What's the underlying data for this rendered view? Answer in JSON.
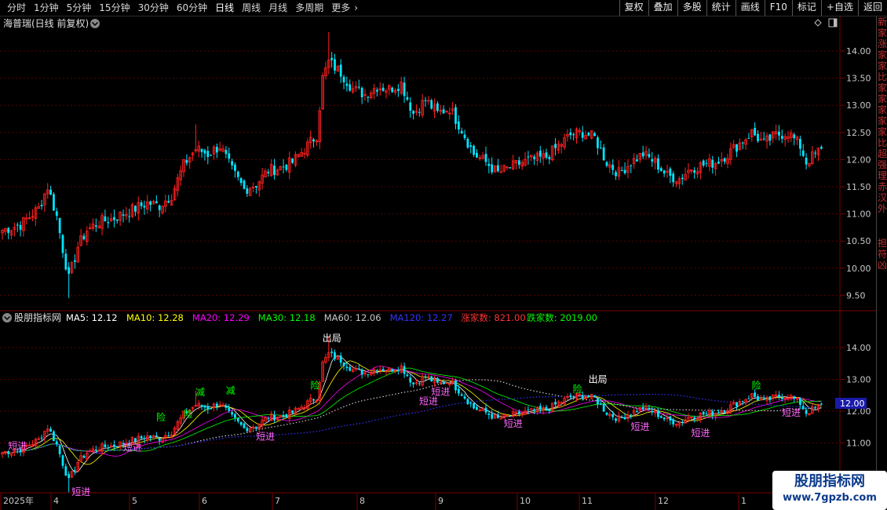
{
  "tabs": [
    {
      "label": "分时",
      "active": false
    },
    {
      "label": "1分钟",
      "active": false
    },
    {
      "label": "5分钟",
      "active": false
    },
    {
      "label": "15分钟",
      "active": false
    },
    {
      "label": "30分钟",
      "active": false
    },
    {
      "label": "60分钟",
      "active": false
    },
    {
      "label": "日线",
      "active": true
    },
    {
      "label": "周线",
      "active": false
    },
    {
      "label": "月线",
      "active": false
    },
    {
      "label": "多周期",
      "active": false
    },
    {
      "label": "更多",
      "active": false
    }
  ],
  "toolbar": [
    "复权",
    "叠加",
    "多股",
    "统计",
    "画线",
    "F10",
    "标记",
    "+自选",
    "返回"
  ],
  "stock": {
    "title": "海普瑞(日线 前复权)"
  },
  "main_axis": {
    "ticks": [
      "14.00",
      "13.50",
      "13.00",
      "12.50",
      "12.00",
      "11.50",
      "11.00",
      "10.50",
      "10.00",
      "9.50"
    ]
  },
  "indicator": {
    "title": "股朋指标网",
    "items": [
      {
        "label": "MA5: 12.12",
        "color": "#ffffff"
      },
      {
        "label": "MA10: 12.28",
        "color": "#ffff00"
      },
      {
        "label": "MA20: 12.29",
        "color": "#ff00ff"
      },
      {
        "label": "MA30: 12.18",
        "color": "#00ff00"
      },
      {
        "label": "MA60: 12.06",
        "color": "#c8c8c8"
      },
      {
        "label": "MA120: 12.27",
        "color": "#3333ff"
      },
      {
        "label": "涨家数: 821.00",
        "color": "#ff3333"
      },
      {
        "label": "跌家数: 2019.00",
        "color": "#00ff00"
      }
    ],
    "axis_ticks": [
      "14.00",
      "13.00",
      "12.00",
      "11.00"
    ],
    "current_value": "12.00"
  },
  "signals": [
    {
      "text": "出局",
      "color": "#ffffff"
    },
    {
      "text": "出局",
      "color": "#ffffff"
    },
    {
      "text": "减",
      "color": "#00ff00"
    },
    {
      "text": "减",
      "color": "#00ff00"
    },
    {
      "text": "险",
      "color": "#00ff00"
    },
    {
      "text": "险",
      "color": "#00ff00"
    },
    {
      "text": "险",
      "color": "#00ff00"
    },
    {
      "text": "险",
      "color": "#00ff00"
    },
    {
      "text": "险",
      "color": "#00ff00"
    },
    {
      "text": "短进",
      "color": "#ff66ff"
    },
    {
      "text": "短进",
      "color": "#ff66ff"
    },
    {
      "text": "短进",
      "color": "#ff66ff"
    },
    {
      "text": "短进",
      "color": "#ff66ff"
    },
    {
      "text": "短进",
      "color": "#ff66ff"
    },
    {
      "text": "短进",
      "color": "#ff66ff"
    },
    {
      "text": "短进",
      "color": "#ff66ff"
    },
    {
      "text": "短进",
      "color": "#ff66ff"
    },
    {
      "text": "短进",
      "color": "#ff66ff"
    },
    {
      "text": "短进",
      "color": "#ff66ff"
    }
  ],
  "time_axis": [
    "2025年",
    "4",
    "5",
    "6",
    "7",
    "8",
    "9",
    "10",
    "11",
    "12",
    "1"
  ],
  "right_strip": [
    "新",
    "家",
    "涨",
    "家",
    "家",
    "比",
    "家",
    "家",
    "家",
    "家",
    "家",
    "比",
    "超",
    "强",
    "理",
    "赤",
    "汉",
    "外",
    "担",
    "符",
    "凶"
  ],
  "watermark": {
    "line1": "股朋指标网",
    "line2": "www.7gpzb.com"
  },
  "colors": {
    "up": "#ff2020",
    "down": "#00e5ff",
    "grid": "#7a0000",
    "axis_text": "#c8c8c8"
  },
  "chart_data": {
    "type": "candlestick",
    "title": "海普瑞(日线 前复权)",
    "ylim": [
      9.3,
      14.5
    ],
    "x_ticks": [
      "2025年",
      "4",
      "5",
      "6",
      "7",
      "8",
      "9",
      "10",
      "11",
      "12",
      "1"
    ],
    "anchors": [
      [
        0,
        10.7
      ],
      [
        6,
        10.8
      ],
      [
        12,
        11.1
      ],
      [
        15,
        11.5
      ],
      [
        18,
        10.95
      ],
      [
        20,
        10.35
      ],
      [
        22,
        9.8
      ],
      [
        25,
        10.4
      ],
      [
        28,
        10.7
      ],
      [
        32,
        10.85
      ],
      [
        36,
        10.9
      ],
      [
        40,
        11.0
      ],
      [
        44,
        11.1
      ],
      [
        48,
        11.2
      ],
      [
        52,
        11.15
      ],
      [
        56,
        11.35
      ],
      [
        60,
        11.9
      ],
      [
        64,
        12.2
      ],
      [
        68,
        12.1
      ],
      [
        72,
        12.25
      ],
      [
        76,
        11.8
      ],
      [
        80,
        11.45
      ],
      [
        84,
        11.55
      ],
      [
        88,
        11.8
      ],
      [
        92,
        11.85
      ],
      [
        96,
        11.95
      ],
      [
        100,
        12.2
      ],
      [
        104,
        12.45
      ],
      [
        106,
        13.5
      ],
      [
        108,
        13.8
      ],
      [
        112,
        13.6
      ],
      [
        116,
        13.3
      ],
      [
        120,
        13.2
      ],
      [
        124,
        13.35
      ],
      [
        128,
        13.3
      ],
      [
        132,
        13.4
      ],
      [
        136,
        12.85
      ],
      [
        140,
        13.1
      ],
      [
        144,
        12.85
      ],
      [
        148,
        12.95
      ],
      [
        152,
        12.55
      ],
      [
        156,
        12.1
      ],
      [
        160,
        11.95
      ],
      [
        164,
        11.75
      ],
      [
        168,
        11.85
      ],
      [
        172,
        11.95
      ],
      [
        176,
        12.0
      ],
      [
        180,
        12.05
      ],
      [
        184,
        12.25
      ],
      [
        188,
        12.45
      ],
      [
        192,
        12.5
      ],
      [
        196,
        12.4
      ],
      [
        200,
        11.95
      ],
      [
        204,
        11.75
      ],
      [
        208,
        11.95
      ],
      [
        212,
        12.1
      ],
      [
        216,
        11.95
      ],
      [
        220,
        11.7
      ],
      [
        224,
        11.65
      ],
      [
        228,
        11.85
      ],
      [
        232,
        11.9
      ],
      [
        236,
        11.95
      ],
      [
        240,
        12.1
      ],
      [
        244,
        12.3
      ],
      [
        248,
        12.5
      ],
      [
        252,
        12.3
      ],
      [
        256,
        12.45
      ],
      [
        260,
        12.5
      ],
      [
        264,
        12.25
      ],
      [
        266,
        11.95
      ],
      [
        270,
        12.15
      ]
    ],
    "series_ma": [
      {
        "name": "MA5",
        "value": 12.12
      },
      {
        "name": "MA10",
        "value": 12.28
      },
      {
        "name": "MA20",
        "value": 12.29
      },
      {
        "name": "MA30",
        "value": 12.18
      },
      {
        "name": "MA60",
        "value": 12.06
      },
      {
        "name": "MA120",
        "value": 12.27
      }
    ],
    "counts": [
      {
        "name": "涨家数",
        "value": 821.0
      },
      {
        "name": "跌家数",
        "value": 2019.0
      }
    ]
  }
}
